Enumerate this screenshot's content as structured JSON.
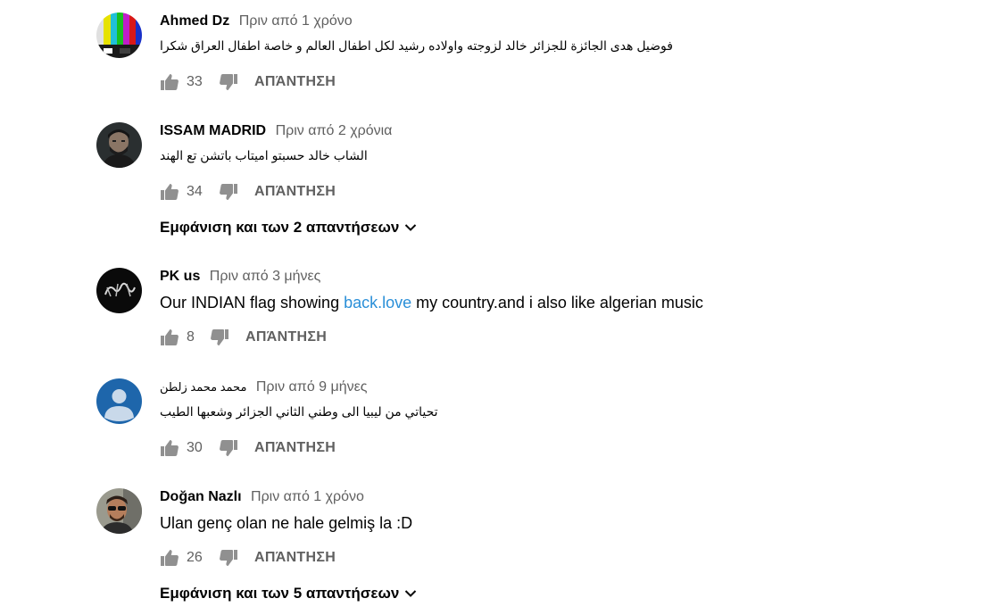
{
  "comments": [
    {
      "author": "Ahmed Dz",
      "time": "Πριν από 1 χρόνο",
      "text": "فوضيل هدى الجائزة للجزائر خالد لزوجته واولاده رشيد لكل اطفال العالم و خاصة اطفال العراق شكرا",
      "likes": "33",
      "reply": "ΑΠΆΝΤΗΣΗ"
    },
    {
      "author": "ISSAM MADRID",
      "time": "Πριν από 2 χρόνια",
      "text": "الشاب خالد حسبتو اميتاب باتشن تع الهند",
      "likes": "34",
      "reply": "ΑΠΆΝΤΗΣΗ",
      "replies_label": "Εμφάνιση και των 2 απαντήσεων"
    },
    {
      "author": "PK us",
      "time": "Πριν από 3 μήνες",
      "text_before": "Our INDIAN flag showing ",
      "link": "back.love",
      "text_after": " my country.and i also like algerian music",
      "likes": "8",
      "reply": "ΑΠΆΝΤΗΣΗ"
    },
    {
      "author": "محمد محمد زلطن",
      "time": "Πριν από 9 μήνες",
      "text": "تحياتي من ليبيا الى وطني الثاني الجزائر وشعبها الطيب",
      "likes": "30",
      "reply": "ΑΠΆΝΤΗΣΗ"
    },
    {
      "author": "Doğan Nazlı",
      "time": "Πριν από 1 χρόνο",
      "text": "Ulan genç olan ne hale gelmiş la :D",
      "likes": "26",
      "reply": "ΑΠΆΝΤΗΣΗ",
      "replies_label": "Εμφάνιση και των 5 απαντήσεων"
    }
  ],
  "icons": {
    "like": "thumb-up-icon",
    "dislike": "thumb-down-icon",
    "expand": "chevron-down-icon"
  },
  "colors": {
    "icon": "#909090",
    "link": "#2a8fd8",
    "secondary_text": "#606060"
  }
}
